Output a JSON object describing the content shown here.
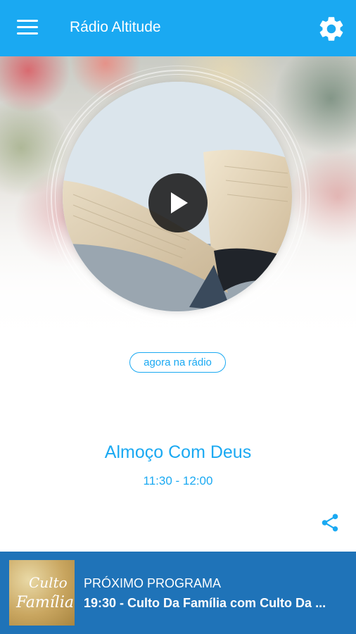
{
  "app_bar": {
    "title": "Rádio Altitude",
    "menu_icon": "hamburger-menu-icon",
    "settings_icon": "gear-icon",
    "color": "#1aa9f2"
  },
  "player": {
    "cover_image": "open-bible-photo",
    "play_icon": "play-icon",
    "state": "paused"
  },
  "now_playing": {
    "badge": "agora na rádio",
    "program": "Almoço Com Deus",
    "time": "11:30 - 12:00",
    "share_icon": "share-icon"
  },
  "next_program": {
    "label": "PRÓXIMO PROGRAMA",
    "title": "19:30 - Culto Da Família com Culto Da ...",
    "thumb_text_1": "Culto",
    "thumb_text_2": "Família",
    "bar_color": "#1f73b8"
  }
}
